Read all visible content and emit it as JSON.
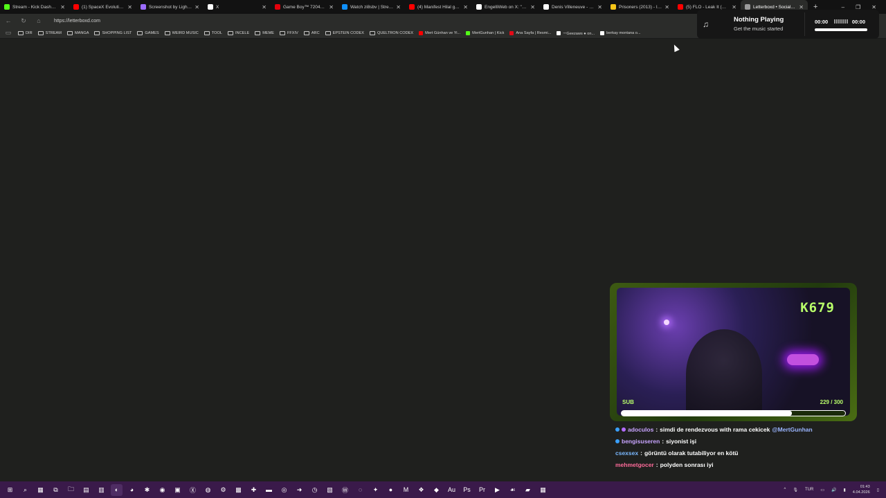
{
  "browser": {
    "tabs": [
      {
        "title": "Stream - Kick Dashboard",
        "favicon_color": "#53fc18",
        "width": 100
      },
      {
        "title": "(1) SpaceX Evolution from...",
        "favicon_color": "#ff0000",
        "width": 97
      },
      {
        "title": "Screenshot by Lightshot",
        "favicon_color": "#9c6cff",
        "width": 97
      },
      {
        "title": "X",
        "favicon_color": "#ffffff",
        "width": 97
      },
      {
        "title": "Game Boy™ 72046 | LEGO",
        "favicon_color": "#e3000b",
        "width": 97
      },
      {
        "title": "Watch zi8sbv | Streamable",
        "favicon_color": "#0f90fa",
        "width": 97
      },
      {
        "title": "(4) Manifest Hilal geçiriyor",
        "favicon_color": "#ff0000",
        "width": 97
      },
      {
        "title": "EngelliWeb on X: \"Yaş doğ...",
        "favicon_color": "#ffffff",
        "width": 97
      },
      {
        "title": "Denis Villeneuve - Wikipedia",
        "favicon_color": "#ffffff",
        "width": 97
      },
      {
        "title": "Prisoners (2013) - IMDb",
        "favicon_color": "#f5c518",
        "width": 97
      },
      {
        "title": "(5) FLO - Leak It (Official V...",
        "favicon_color": "#ff0000",
        "width": 97
      },
      {
        "title": "Letterboxd • Social film di...",
        "favicon_color": "#9a9a9a",
        "width": 97,
        "active": true
      }
    ],
    "new_tab_symbol": "+",
    "window_controls": {
      "minimize": "–",
      "restore": "❐",
      "close": "✕"
    },
    "url": "https://letterboxd.com",
    "bookmarks": [
      {
        "label": "DIR",
        "type": "folder"
      },
      {
        "label": "STREAM",
        "type": "folder"
      },
      {
        "label": "MANGA",
        "type": "folder"
      },
      {
        "label": "SHOPPING LIST",
        "type": "folder"
      },
      {
        "label": "GAMES",
        "type": "folder"
      },
      {
        "label": "WEIRD MUSIC",
        "type": "folder"
      },
      {
        "label": "TOOL",
        "type": "folder"
      },
      {
        "label": "INCELE",
        "type": "folder"
      },
      {
        "label": "MEME",
        "type": "folder"
      },
      {
        "label": "FFXIV",
        "type": "folder"
      },
      {
        "label": "ARC",
        "type": "folder"
      },
      {
        "label": "EPSTEIN CODEX",
        "type": "folder"
      },
      {
        "label": "QUELTRON CODEX",
        "type": "folder"
      },
      {
        "label": "Mert Günhan ve Yi...",
        "type": "link",
        "favicon_color": "#ff0000"
      },
      {
        "label": "MertGunhan | Kick",
        "type": "link",
        "favicon_color": "#53fc18"
      },
      {
        "label": "Ana Sayfa | Resmi...",
        "type": "link",
        "favicon_color": "#e30a17"
      },
      {
        "label": "ᅲGeezaws ● on...",
        "type": "link",
        "favicon_color": "#ffffff"
      },
      {
        "label": "berkay montana o...",
        "type": "link",
        "favicon_color": "#ffffff"
      }
    ]
  },
  "music_widget": {
    "title": "Nothing Playing",
    "subtitle": "Get the music started",
    "time_current": "00:00",
    "time_total": "00:00",
    "icon": "music-note-icon"
  },
  "stream_overlay": {
    "channel_logo_text": "K679",
    "sub_label": "SUB",
    "sub_count_text": "229 / 300",
    "sub_progress": 0.763,
    "accent": "#b9ff6a"
  },
  "chat": [
    {
      "user": "adoculos",
      "user_color": "#c8a4ff",
      "badges": [
        "#3aa0ff",
        "#b36cff"
      ],
      "text": "simdi de rendezvous with rama cekicek",
      "mention": "@MertGunhan"
    },
    {
      "user": "bengisuseren",
      "user_color": "#c8a4ff",
      "badges": [
        "#3aa0ff"
      ],
      "text": "siyonist işi",
      "mention": ""
    },
    {
      "user": "csexsex",
      "user_color": "#7ab8ff",
      "badges": [],
      "text": "görüntü olarak tutabiliyor en kötü",
      "mention": ""
    },
    {
      "user": "mehmetgocer",
      "user_color": "#ff6b9a",
      "badges": [],
      "text": "polyden sonrası iyi",
      "mention": ""
    }
  ],
  "taskbar": {
    "apps": [
      {
        "icon": "windows-start-icon",
        "glyph": "⊞"
      },
      {
        "icon": "search-icon",
        "glyph": "⌕"
      },
      {
        "icon": "widgets-icon",
        "glyph": "▦"
      },
      {
        "icon": "task-view-icon",
        "glyph": "⧉"
      },
      {
        "icon": "file-explorer-icon",
        "glyph": "🗀"
      },
      {
        "icon": "calculator-icon",
        "glyph": "▤"
      },
      {
        "icon": "notes-icon",
        "glyph": "▥"
      },
      {
        "icon": "edge-icon",
        "glyph": "◐",
        "active": true
      },
      {
        "icon": "discord-icon",
        "glyph": "◕"
      },
      {
        "icon": "app-icon",
        "glyph": "✱"
      },
      {
        "icon": "steam-icon",
        "glyph": "◉"
      },
      {
        "icon": "terminal-icon",
        "glyph": "▣"
      },
      {
        "icon": "xbox-icon",
        "glyph": "Ⓧ"
      },
      {
        "icon": "spotify-icon",
        "glyph": "◍"
      },
      {
        "icon": "steam-icon-2",
        "glyph": "⚙"
      },
      {
        "icon": "app-icon-2",
        "glyph": "▩"
      },
      {
        "icon": "app-icon-3",
        "glyph": "✚"
      },
      {
        "icon": "app-icon-4",
        "glyph": "▬"
      },
      {
        "icon": "obs-icon",
        "glyph": "◎"
      },
      {
        "icon": "app-icon-5",
        "glyph": "➜"
      },
      {
        "icon": "app-icon-6",
        "glyph": "◷"
      },
      {
        "icon": "app-icon-7",
        "glyph": "▧"
      },
      {
        "icon": "wordpad-icon",
        "glyph": "Ⓦ"
      },
      {
        "icon": "chrome-icon",
        "glyph": "◌"
      },
      {
        "icon": "app-icon-8",
        "glyph": "✦"
      },
      {
        "icon": "app-icon-9",
        "glyph": "●"
      },
      {
        "icon": "app-icon-10",
        "glyph": "M"
      },
      {
        "icon": "app-icon-11",
        "glyph": "❖"
      },
      {
        "icon": "app-icon-12",
        "glyph": "◆"
      },
      {
        "icon": "audition-icon",
        "glyph": "Au"
      },
      {
        "icon": "photoshop-icon",
        "glyph": "Ps"
      },
      {
        "icon": "premiere-icon",
        "glyph": "Pr"
      },
      {
        "icon": "app-icon-13",
        "glyph": "▶"
      },
      {
        "icon": "app-icon-14",
        "glyph": "☙"
      },
      {
        "icon": "app-icon-15",
        "glyph": "▰"
      },
      {
        "icon": "app-icon-16",
        "glyph": "▦"
      }
    ],
    "language": "TUR",
    "time": "01:43",
    "date": "4.04.2026"
  }
}
